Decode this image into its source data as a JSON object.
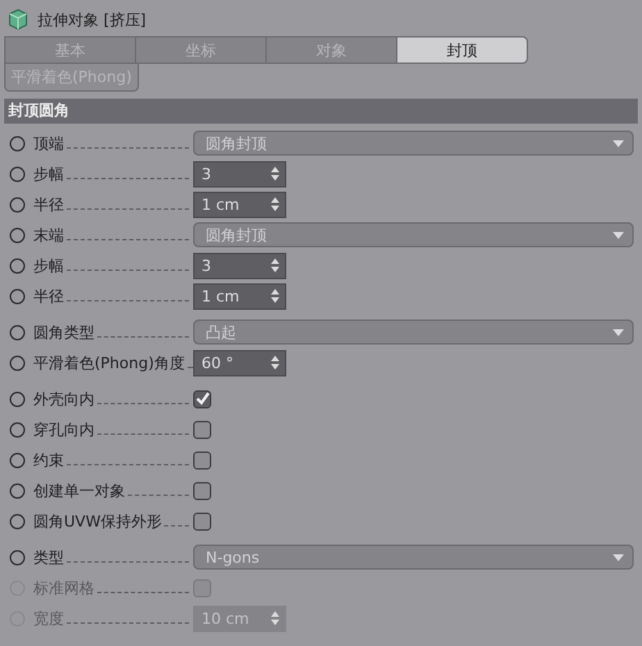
{
  "title": "拉伸对象 [挤压]",
  "tabs": [
    {
      "label": "基本",
      "selected": false
    },
    {
      "label": "坐标",
      "selected": false
    },
    {
      "label": "对象",
      "selected": false
    },
    {
      "label": "封顶",
      "selected": true
    },
    {
      "label": "平滑着色(Phong)",
      "selected": false
    }
  ],
  "section": "封顶圆角",
  "groups": [
    {
      "rows": [
        {
          "kind": "dropdown",
          "label": "顶端",
          "value": "圆角封顶",
          "disabled": false
        },
        {
          "kind": "number",
          "label": "步幅",
          "value": "3",
          "disabled": false
        },
        {
          "kind": "number",
          "label": "半径",
          "value": "1 cm",
          "disabled": false
        },
        {
          "kind": "dropdown",
          "label": "末端",
          "value": "圆角封顶",
          "disabled": false
        },
        {
          "kind": "number",
          "label": "步幅",
          "value": "3",
          "disabled": false
        },
        {
          "kind": "number",
          "label": "半径",
          "value": "1 cm",
          "disabled": false
        }
      ]
    },
    {
      "rows": [
        {
          "kind": "dropdown",
          "label": "圆角类型",
          "value": "凸起",
          "disabled": false
        },
        {
          "kind": "number",
          "label": "平滑着色(Phong)角度",
          "value": "60 °",
          "disabled": false
        }
      ]
    },
    {
      "rows": [
        {
          "kind": "checkbox",
          "label": "外壳向内",
          "checked": true,
          "disabled": false
        },
        {
          "kind": "checkbox",
          "label": "穿孔向内",
          "checked": false,
          "disabled": false
        },
        {
          "kind": "checkbox",
          "label": "约束",
          "checked": false,
          "disabled": false
        },
        {
          "kind": "checkbox",
          "label": "创建单一对象",
          "checked": false,
          "disabled": false
        },
        {
          "kind": "checkbox",
          "label": "圆角UVW保持外形",
          "checked": false,
          "disabled": false
        }
      ]
    },
    {
      "rows": [
        {
          "kind": "dropdown",
          "label": "类型",
          "value": "N-gons",
          "disabled": false
        },
        {
          "kind": "checkbox",
          "label": "标准网格",
          "checked": false,
          "disabled": true
        },
        {
          "kind": "number",
          "label": "宽度",
          "value": "10 cm",
          "disabled": true
        }
      ]
    }
  ]
}
